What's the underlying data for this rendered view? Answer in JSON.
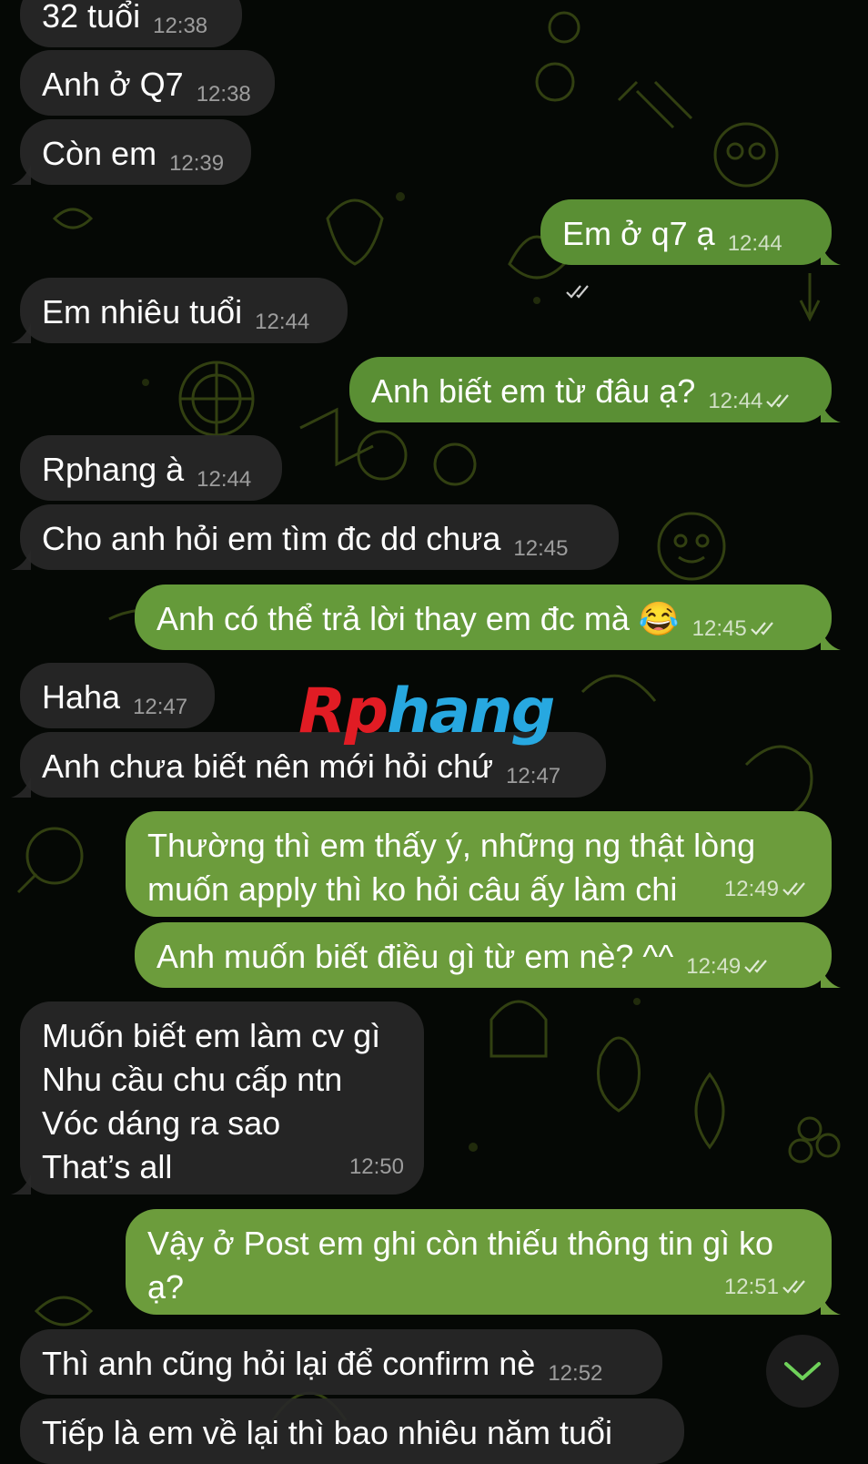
{
  "messages": [
    {
      "dir": "in",
      "text": "32 tuổi",
      "time": "12:38"
    },
    {
      "dir": "in",
      "text": "Anh ở Q7",
      "time": "12:38"
    },
    {
      "dir": "in",
      "text": "Còn em",
      "time": "12:39"
    },
    {
      "dir": "out",
      "text": "Em ở q7 ạ",
      "time": "12:44"
    },
    {
      "dir": "in",
      "text": "Em nhiêu tuổi",
      "time": "12:44"
    },
    {
      "dir": "out",
      "text": "Anh biết em từ đâu ạ?",
      "time": "12:44"
    },
    {
      "dir": "in",
      "text": "Rphang à",
      "time": "12:44"
    },
    {
      "dir": "in",
      "text": "Cho anh hỏi em tìm đc dd chưa",
      "time": "12:45"
    },
    {
      "dir": "out",
      "text": "Anh có thể trả lời thay em đc mà 😂",
      "time": "12:45"
    },
    {
      "dir": "in",
      "text": "Haha",
      "time": "12:47"
    },
    {
      "dir": "in",
      "text": "Anh chưa biết nên mới hỏi chứ",
      "time": "12:47"
    },
    {
      "dir": "out",
      "text": "Thường thì em thấy ý, những ng thật lòng\nmuốn apply thì ko hỏi câu ấy làm chi",
      "time": "12:49"
    },
    {
      "dir": "out",
      "text": "Anh muốn biết điều gì từ em nè? ^^",
      "time": "12:49"
    },
    {
      "dir": "in",
      "text": "Muốn biết em làm cv gì\nNhu cầu chu cấp ntn\nVóc dáng ra sao\nThat’s all",
      "time": "12:50"
    },
    {
      "dir": "out",
      "text": "Vậy ở Post em ghi còn thiếu thông tin gì ko\nạ?",
      "time": "12:51"
    },
    {
      "dir": "in",
      "text": "Thì anh cũng hỏi lại để confirm nè",
      "time": "12:52"
    },
    {
      "dir": "in",
      "text": "Tiếp là em về lại thì bao nhiêu năm tuổi",
      "time": ""
    }
  ],
  "watermark": {
    "part1": "Rp",
    "part2": "hang"
  },
  "icons": {
    "read": "double-check-icon",
    "scroll": "chevron-down-icon"
  },
  "colors": {
    "incoming": "#282828",
    "outgoing": "#5a8f34",
    "accent": "#6fd15a"
  }
}
